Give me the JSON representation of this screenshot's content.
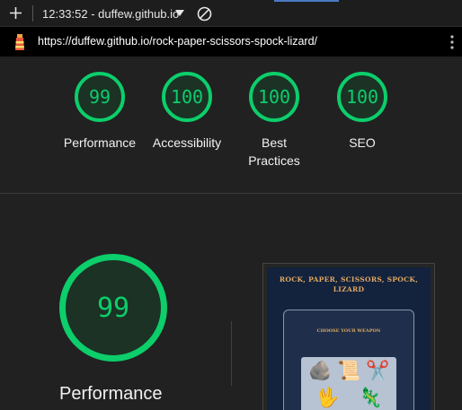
{
  "browser": {
    "tab_title": "12:33:52 - duffew.github.io",
    "url": "https://duffew.github.io/rock-paper-scissors-spock-lizard/",
    "accent_color": "#4a78c2"
  },
  "icons": {
    "new_tab": "plus-icon",
    "dropdown": "chevron-down-icon",
    "block": "block-icon",
    "site": "lighthouse-icon",
    "menu": "kebab-menu-icon"
  },
  "gauges": [
    {
      "score": "99",
      "label": "Performance"
    },
    {
      "score": "100",
      "label": "Accessibility"
    },
    {
      "score": "100",
      "label": "Best Practices"
    },
    {
      "score": "100",
      "label": "SEO"
    }
  ],
  "performance": {
    "score": "99",
    "label": "Performance"
  },
  "colors": {
    "pass": "#0cce6b",
    "pass_fill": "#1b3225",
    "background": "#212121"
  },
  "screenshot": {
    "title": "ROCK, PAPER, SCISSORS, SPOCK, LIZARD",
    "subtitle": "CHOOSE YOUR WEAPON",
    "weapons": [
      "🪨",
      "📜",
      "✂️",
      "🖖",
      "🦎"
    ]
  }
}
